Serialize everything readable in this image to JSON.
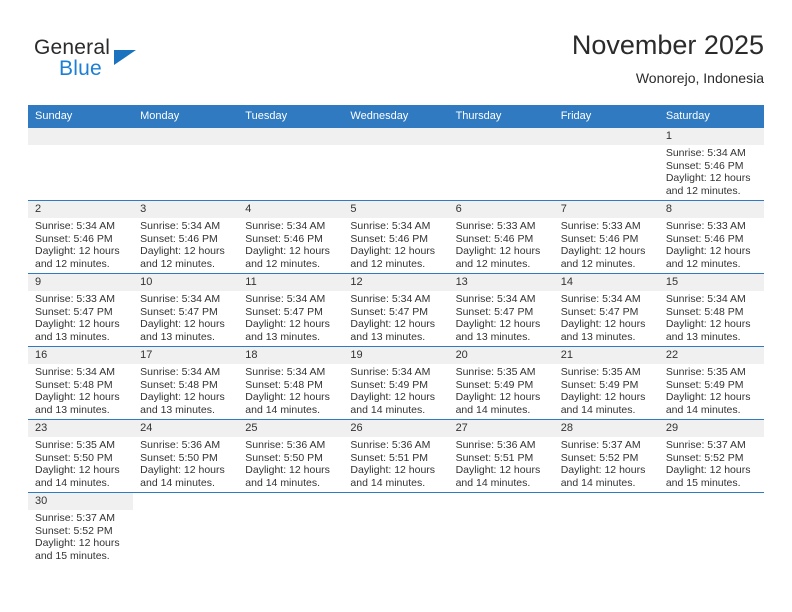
{
  "brand": {
    "name_top": "General",
    "name_bottom": "Blue",
    "accent_color": "#1b72bf"
  },
  "header": {
    "title": "November 2025",
    "subtitle": "Wonorejo, Indonesia"
  },
  "theme": {
    "header_bg": "#2f7ac0",
    "daynum_bg": "#f0f0f0",
    "text": "#333333"
  },
  "weekdays": [
    "Sunday",
    "Monday",
    "Tuesday",
    "Wednesday",
    "Thursday",
    "Friday",
    "Saturday"
  ],
  "weeks": [
    [
      {
        "type": "placeholder"
      },
      {
        "type": "placeholder"
      },
      {
        "type": "placeholder"
      },
      {
        "type": "placeholder"
      },
      {
        "type": "placeholder"
      },
      {
        "type": "placeholder"
      },
      {
        "type": "day",
        "day": "1",
        "sunrise": "Sunrise: 5:34 AM",
        "sunset": "Sunset: 5:46 PM",
        "daylight1": "Daylight: 12 hours",
        "daylight2": "and 12 minutes."
      }
    ],
    [
      {
        "type": "day",
        "day": "2",
        "sunrise": "Sunrise: 5:34 AM",
        "sunset": "Sunset: 5:46 PM",
        "daylight1": "Daylight: 12 hours",
        "daylight2": "and 12 minutes."
      },
      {
        "type": "day",
        "day": "3",
        "sunrise": "Sunrise: 5:34 AM",
        "sunset": "Sunset: 5:46 PM",
        "daylight1": "Daylight: 12 hours",
        "daylight2": "and 12 minutes."
      },
      {
        "type": "day",
        "day": "4",
        "sunrise": "Sunrise: 5:34 AM",
        "sunset": "Sunset: 5:46 PM",
        "daylight1": "Daylight: 12 hours",
        "daylight2": "and 12 minutes."
      },
      {
        "type": "day",
        "day": "5",
        "sunrise": "Sunrise: 5:34 AM",
        "sunset": "Sunset: 5:46 PM",
        "daylight1": "Daylight: 12 hours",
        "daylight2": "and 12 minutes."
      },
      {
        "type": "day",
        "day": "6",
        "sunrise": "Sunrise: 5:33 AM",
        "sunset": "Sunset: 5:46 PM",
        "daylight1": "Daylight: 12 hours",
        "daylight2": "and 12 minutes."
      },
      {
        "type": "day",
        "day": "7",
        "sunrise": "Sunrise: 5:33 AM",
        "sunset": "Sunset: 5:46 PM",
        "daylight1": "Daylight: 12 hours",
        "daylight2": "and 12 minutes."
      },
      {
        "type": "day",
        "day": "8",
        "sunrise": "Sunrise: 5:33 AM",
        "sunset": "Sunset: 5:46 PM",
        "daylight1": "Daylight: 12 hours",
        "daylight2": "and 12 minutes."
      }
    ],
    [
      {
        "type": "day",
        "day": "9",
        "sunrise": "Sunrise: 5:33 AM",
        "sunset": "Sunset: 5:47 PM",
        "daylight1": "Daylight: 12 hours",
        "daylight2": "and 13 minutes."
      },
      {
        "type": "day",
        "day": "10",
        "sunrise": "Sunrise: 5:34 AM",
        "sunset": "Sunset: 5:47 PM",
        "daylight1": "Daylight: 12 hours",
        "daylight2": "and 13 minutes."
      },
      {
        "type": "day",
        "day": "11",
        "sunrise": "Sunrise: 5:34 AM",
        "sunset": "Sunset: 5:47 PM",
        "daylight1": "Daylight: 12 hours",
        "daylight2": "and 13 minutes."
      },
      {
        "type": "day",
        "day": "12",
        "sunrise": "Sunrise: 5:34 AM",
        "sunset": "Sunset: 5:47 PM",
        "daylight1": "Daylight: 12 hours",
        "daylight2": "and 13 minutes."
      },
      {
        "type": "day",
        "day": "13",
        "sunrise": "Sunrise: 5:34 AM",
        "sunset": "Sunset: 5:47 PM",
        "daylight1": "Daylight: 12 hours",
        "daylight2": "and 13 minutes."
      },
      {
        "type": "day",
        "day": "14",
        "sunrise": "Sunrise: 5:34 AM",
        "sunset": "Sunset: 5:47 PM",
        "daylight1": "Daylight: 12 hours",
        "daylight2": "and 13 minutes."
      },
      {
        "type": "day",
        "day": "15",
        "sunrise": "Sunrise: 5:34 AM",
        "sunset": "Sunset: 5:48 PM",
        "daylight1": "Daylight: 12 hours",
        "daylight2": "and 13 minutes."
      }
    ],
    [
      {
        "type": "day",
        "day": "16",
        "sunrise": "Sunrise: 5:34 AM",
        "sunset": "Sunset: 5:48 PM",
        "daylight1": "Daylight: 12 hours",
        "daylight2": "and 13 minutes."
      },
      {
        "type": "day",
        "day": "17",
        "sunrise": "Sunrise: 5:34 AM",
        "sunset": "Sunset: 5:48 PM",
        "daylight1": "Daylight: 12 hours",
        "daylight2": "and 13 minutes."
      },
      {
        "type": "day",
        "day": "18",
        "sunrise": "Sunrise: 5:34 AM",
        "sunset": "Sunset: 5:48 PM",
        "daylight1": "Daylight: 12 hours",
        "daylight2": "and 14 minutes."
      },
      {
        "type": "day",
        "day": "19",
        "sunrise": "Sunrise: 5:34 AM",
        "sunset": "Sunset: 5:49 PM",
        "daylight1": "Daylight: 12 hours",
        "daylight2": "and 14 minutes."
      },
      {
        "type": "day",
        "day": "20",
        "sunrise": "Sunrise: 5:35 AM",
        "sunset": "Sunset: 5:49 PM",
        "daylight1": "Daylight: 12 hours",
        "daylight2": "and 14 minutes."
      },
      {
        "type": "day",
        "day": "21",
        "sunrise": "Sunrise: 5:35 AM",
        "sunset": "Sunset: 5:49 PM",
        "daylight1": "Daylight: 12 hours",
        "daylight2": "and 14 minutes."
      },
      {
        "type": "day",
        "day": "22",
        "sunrise": "Sunrise: 5:35 AM",
        "sunset": "Sunset: 5:49 PM",
        "daylight1": "Daylight: 12 hours",
        "daylight2": "and 14 minutes."
      }
    ],
    [
      {
        "type": "day",
        "day": "23",
        "sunrise": "Sunrise: 5:35 AM",
        "sunset": "Sunset: 5:50 PM",
        "daylight1": "Daylight: 12 hours",
        "daylight2": "and 14 minutes."
      },
      {
        "type": "day",
        "day": "24",
        "sunrise": "Sunrise: 5:36 AM",
        "sunset": "Sunset: 5:50 PM",
        "daylight1": "Daylight: 12 hours",
        "daylight2": "and 14 minutes."
      },
      {
        "type": "day",
        "day": "25",
        "sunrise": "Sunrise: 5:36 AM",
        "sunset": "Sunset: 5:50 PM",
        "daylight1": "Daylight: 12 hours",
        "daylight2": "and 14 minutes."
      },
      {
        "type": "day",
        "day": "26",
        "sunrise": "Sunrise: 5:36 AM",
        "sunset": "Sunset: 5:51 PM",
        "daylight1": "Daylight: 12 hours",
        "daylight2": "and 14 minutes."
      },
      {
        "type": "day",
        "day": "27",
        "sunrise": "Sunrise: 5:36 AM",
        "sunset": "Sunset: 5:51 PM",
        "daylight1": "Daylight: 12 hours",
        "daylight2": "and 14 minutes."
      },
      {
        "type": "day",
        "day": "28",
        "sunrise": "Sunrise: 5:37 AM",
        "sunset": "Sunset: 5:52 PM",
        "daylight1": "Daylight: 12 hours",
        "daylight2": "and 14 minutes."
      },
      {
        "type": "day",
        "day": "29",
        "sunrise": "Sunrise: 5:37 AM",
        "sunset": "Sunset: 5:52 PM",
        "daylight1": "Daylight: 12 hours",
        "daylight2": "and 15 minutes."
      }
    ],
    [
      {
        "type": "day",
        "day": "30",
        "sunrise": "Sunrise: 5:37 AM",
        "sunset": "Sunset: 5:52 PM",
        "daylight1": "Daylight: 12 hours",
        "daylight2": "and 15 minutes."
      },
      {
        "type": "none"
      },
      {
        "type": "none"
      },
      {
        "type": "none"
      },
      {
        "type": "none"
      },
      {
        "type": "none"
      },
      {
        "type": "none"
      }
    ]
  ]
}
